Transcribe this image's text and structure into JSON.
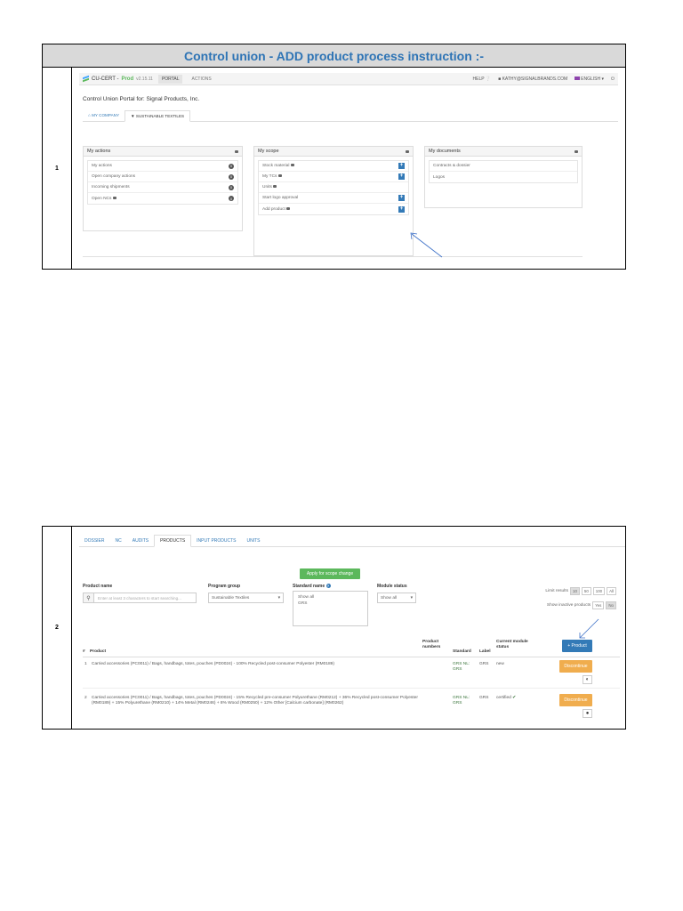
{
  "document": {
    "title": "Control union - ADD product process instruction :-",
    "step1_number": "1",
    "step2_number": "2"
  },
  "shot1": {
    "brand_name": "CU-CERT - ",
    "brand_env": "Prod",
    "brand_version": "v2.15.11",
    "nav": [
      "PORTAL",
      "ACTIONS"
    ],
    "help": "HELP",
    "user_email": "KATHY@SIGNALBRANDS.COM",
    "language": "ENGLISH",
    "portal_title": "Control Union Portal for: Signal Products, Inc.",
    "company_tabs": [
      "MY COMPANY",
      "SUSTAINABLE TEXTILES"
    ],
    "panels": {
      "actions": {
        "title": "My actions",
        "items": [
          {
            "label": "My actions",
            "badge": "0"
          },
          {
            "label": "Open company actions",
            "badge": "0"
          },
          {
            "label": "Incoming shipments",
            "badge": "0"
          },
          {
            "label": "Open NCs",
            "badge": "0"
          }
        ]
      },
      "scope": {
        "title": "My scope",
        "items": [
          {
            "label": "Stock material"
          },
          {
            "label": "My TCs"
          },
          {
            "label": "Units"
          },
          {
            "label": "Start logo approval"
          },
          {
            "label": "Add product"
          }
        ]
      },
      "documents": {
        "title": "My documents",
        "items": [
          {
            "label": "Contracts & dossier"
          },
          {
            "label": "Logos"
          }
        ]
      }
    }
  },
  "shot2": {
    "tabs": [
      "DOSSIER",
      "NC",
      "AUDITS",
      "PRODUCTS",
      "INPUT PRODUCTS",
      "UNITS"
    ],
    "apply_button": "Apply for scope change",
    "filters": {
      "product_name_label": "Product name",
      "product_name_placeholder": "Enter at least 3 characters to start searching...",
      "program_group_label": "Program group",
      "program_group_value": "Sustainable Textiles",
      "standard_name_label": "Standard name",
      "standard_options": [
        "Show all",
        "GRS"
      ],
      "module_status_label": "Module status",
      "module_status_value": "Show all",
      "limit_results_label": "Limit results",
      "limit_options": [
        "10",
        "50",
        "100",
        "All"
      ],
      "show_inactive_label": "Show inactive products",
      "inactive_options": [
        "Yes",
        "No"
      ]
    },
    "columns": {
      "num": "#",
      "product": "Product",
      "product_numbers": "Product numbers",
      "standard": "Standard",
      "label": "Label",
      "status": "Current module status"
    },
    "add_product_button": "Product",
    "rows": [
      {
        "num": "1",
        "product": "Carried accessories (PC0011) / Bags, handbags, totes, pouches (PD0024) - 100% Recycled post-consumer Polyester (RM0189)",
        "standard_line1": "GRS NL:",
        "standard_line2": "GRS",
        "label": "GRS",
        "status": "new",
        "action": "Discontinue"
      },
      {
        "num": "2",
        "product": "Carried accessories (PC0011) / Bags, handbags, totes, pouches (PD0024) - 15% Recycled pre-consumer Polyurethane (RM0212) + 36% Recycled post-consumer Polyester (RM0189) + 15% Polyurethane (RM0210) + 14% Metal (RM0246) + 8% Wood (RM0250) + 12% Other [Calcium carbonate] (RM0262)",
        "standard_line1": "GRS NL:",
        "standard_line2": "GRS",
        "label": "GRS",
        "status": "certified",
        "action": "Discontinue"
      }
    ]
  },
  "colors": {
    "title_blue": "#2e74b5",
    "primary": "#337ab7",
    "success": "#5cb85c",
    "warning": "#f0ad4e"
  }
}
